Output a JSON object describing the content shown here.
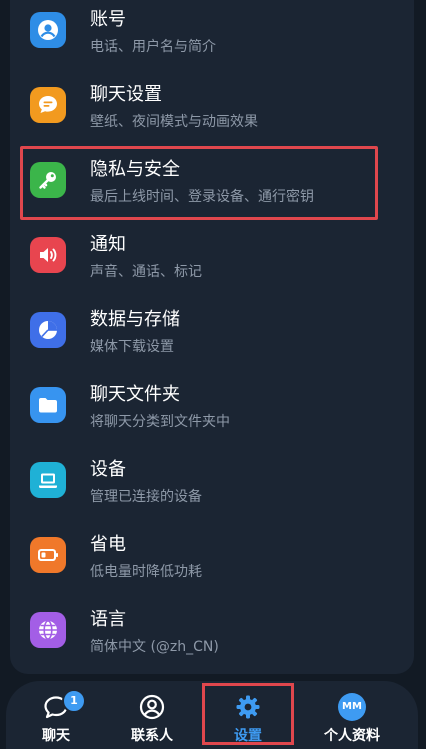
{
  "settings": {
    "items": [
      {
        "title": "账号",
        "subtitle": "电话、用户名与简介",
        "icon": "person-icon",
        "color": "#2e8de6"
      },
      {
        "title": "聊天设置",
        "subtitle": "壁纸、夜间模式与动画效果",
        "icon": "chat-bubble-icon",
        "color": "#f29a1f"
      },
      {
        "title": "隐私与安全",
        "subtitle": "最后上线时间、登录设备、通行密钥",
        "icon": "key-icon",
        "color": "#3bb54a"
      },
      {
        "title": "通知",
        "subtitle": "声音、通话、标记",
        "icon": "speaker-icon",
        "color": "#e8454f"
      },
      {
        "title": "数据与存储",
        "subtitle": "媒体下载设置",
        "icon": "pie-chart-icon",
        "color": "#3f6fe8"
      },
      {
        "title": "聊天文件夹",
        "subtitle": "将聊天分类到文件夹中",
        "icon": "folder-icon",
        "color": "#3794f0"
      },
      {
        "title": "设备",
        "subtitle": "管理已连接的设备",
        "icon": "laptop-icon",
        "color": "#1fb1d6"
      },
      {
        "title": "省电",
        "subtitle": "低电量时降低功耗",
        "icon": "battery-icon",
        "color": "#f0782a"
      },
      {
        "title": "语言",
        "subtitle": "简体中文 (@zh_CN)",
        "icon": "globe-icon",
        "color": "#a35ee6"
      }
    ]
  },
  "nav": {
    "chats": {
      "label": "聊天",
      "badge": "1"
    },
    "contacts": {
      "label": "联系人"
    },
    "settings": {
      "label": "设置"
    },
    "profile": {
      "label": "个人资料",
      "avatar": "MM"
    }
  },
  "colors": {
    "accent": "#3e9bf2",
    "highlight": "#e0474d"
  }
}
